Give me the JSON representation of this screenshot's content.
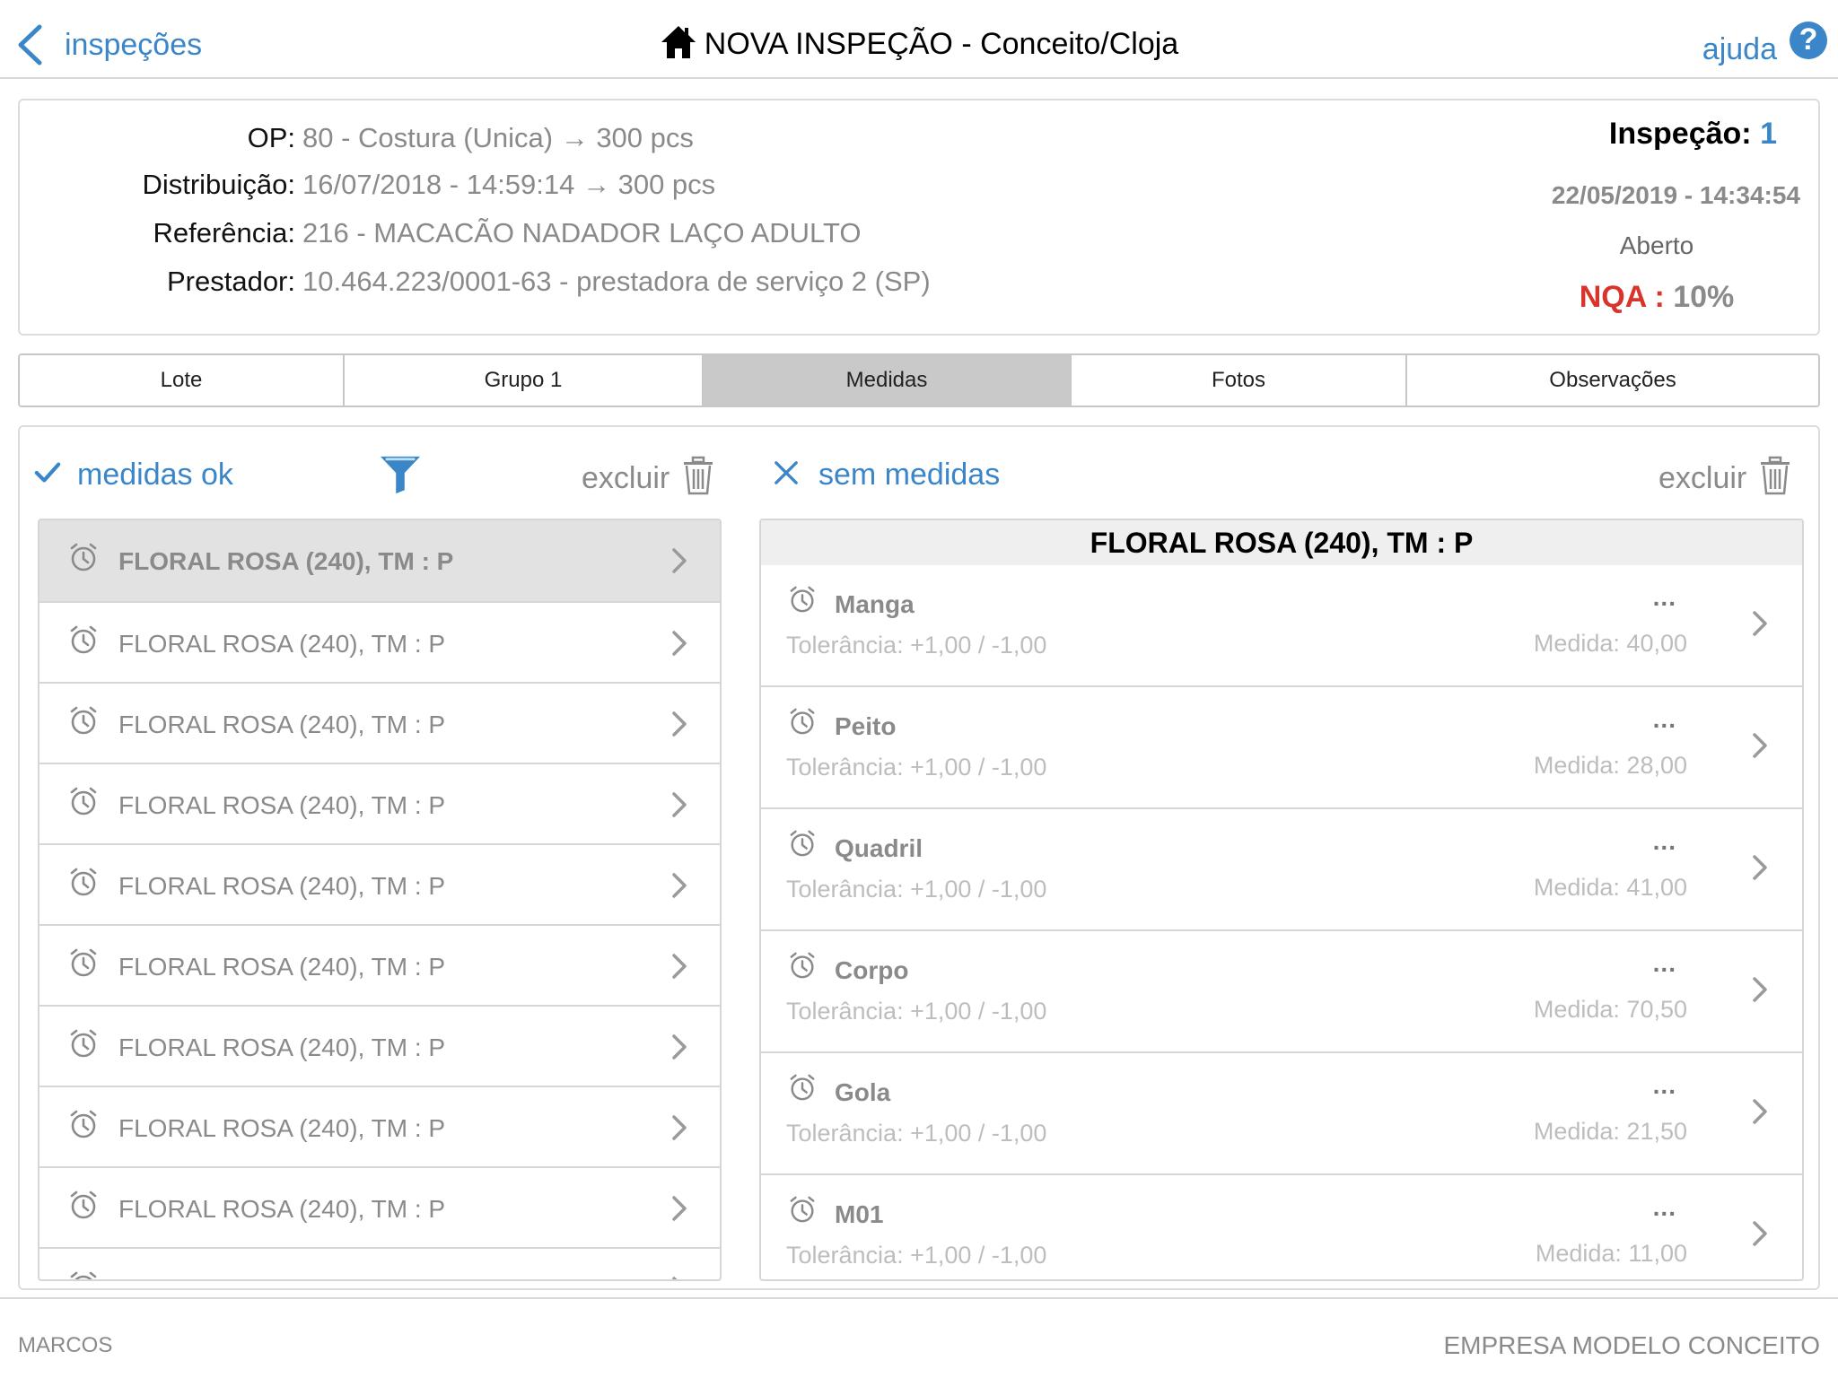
{
  "nav": {
    "back_label": "inspeções",
    "title": "NOVA INSPEÇÃO - Conceito/Cloja",
    "help_label": "ajuda",
    "help_icon": "question-icon"
  },
  "info": {
    "op_label": "OP:",
    "op_value": "80 - Costura (Unica) → 300 pcs",
    "dist_label": "Distribuição:",
    "dist_value": "16/07/2018 - 14:59:14 → 300 pcs",
    "ref_label": "Referência:",
    "ref_value": "216 - MACACÃO NADADOR LAÇO ADULTO",
    "prest_label": "Prestador:",
    "prest_value": "10.464.223/0001-63 - prestadora de serviço 2 (SP)",
    "inspecao_label": "Inspeção:",
    "inspecao_num": "1",
    "datetime": "22/05/2019 - 14:34:54",
    "status": "Aberto",
    "nqa_label": "NQA :",
    "nqa_value": "10%"
  },
  "tabs": [
    "Lote",
    "Grupo 1",
    "Medidas",
    "Fotos",
    "Observações"
  ],
  "active_tab": "Medidas",
  "left": {
    "ok_label": "medidas ok",
    "delete_label": "excluir",
    "items": [
      "FLORAL ROSA (240), TM : P",
      "FLORAL ROSA (240), TM : P",
      "FLORAL ROSA (240), TM : P",
      "FLORAL ROSA (240), TM : P",
      "FLORAL ROSA (240), TM : P",
      "FLORAL ROSA (240), TM : P",
      "FLORAL ROSA (240), TM : P",
      "FLORAL ROSA (240), TM : P",
      "FLORAL ROSA (240), TM : P"
    ]
  },
  "right": {
    "none_label": "sem medidas",
    "delete_label": "excluir",
    "title": "FLORAL ROSA (240), TM : P",
    "items": [
      {
        "name": "Manga",
        "dots": "...",
        "tol": "Tolerância: +1,00 / -1,00",
        "med": "Medida: 40,00"
      },
      {
        "name": "Peito",
        "dots": "...",
        "tol": "Tolerância: +1,00 / -1,00",
        "med": "Medida: 28,00"
      },
      {
        "name": "Quadril",
        "dots": "...",
        "tol": "Tolerância: +1,00 / -1,00",
        "med": "Medida: 41,00"
      },
      {
        "name": "Corpo",
        "dots": "...",
        "tol": "Tolerância: +1,00 / -1,00",
        "med": "Medida: 70,50"
      },
      {
        "name": "Gola",
        "dots": "...",
        "tol": "Tolerância: +1,00 / -1,00",
        "med": "Medida: 21,50"
      },
      {
        "name": "M01",
        "dots": "...",
        "tol": "Tolerância: +1,00 / -1,00",
        "med": "Medida: 11,00"
      }
    ]
  },
  "footer": {
    "user": "MARCOS",
    "company": "EMPRESA MODELO CONCEITO"
  },
  "colors": {
    "accent": "#3a86c8",
    "nqa": "#d9342b",
    "muted": "#8a8a8a"
  }
}
